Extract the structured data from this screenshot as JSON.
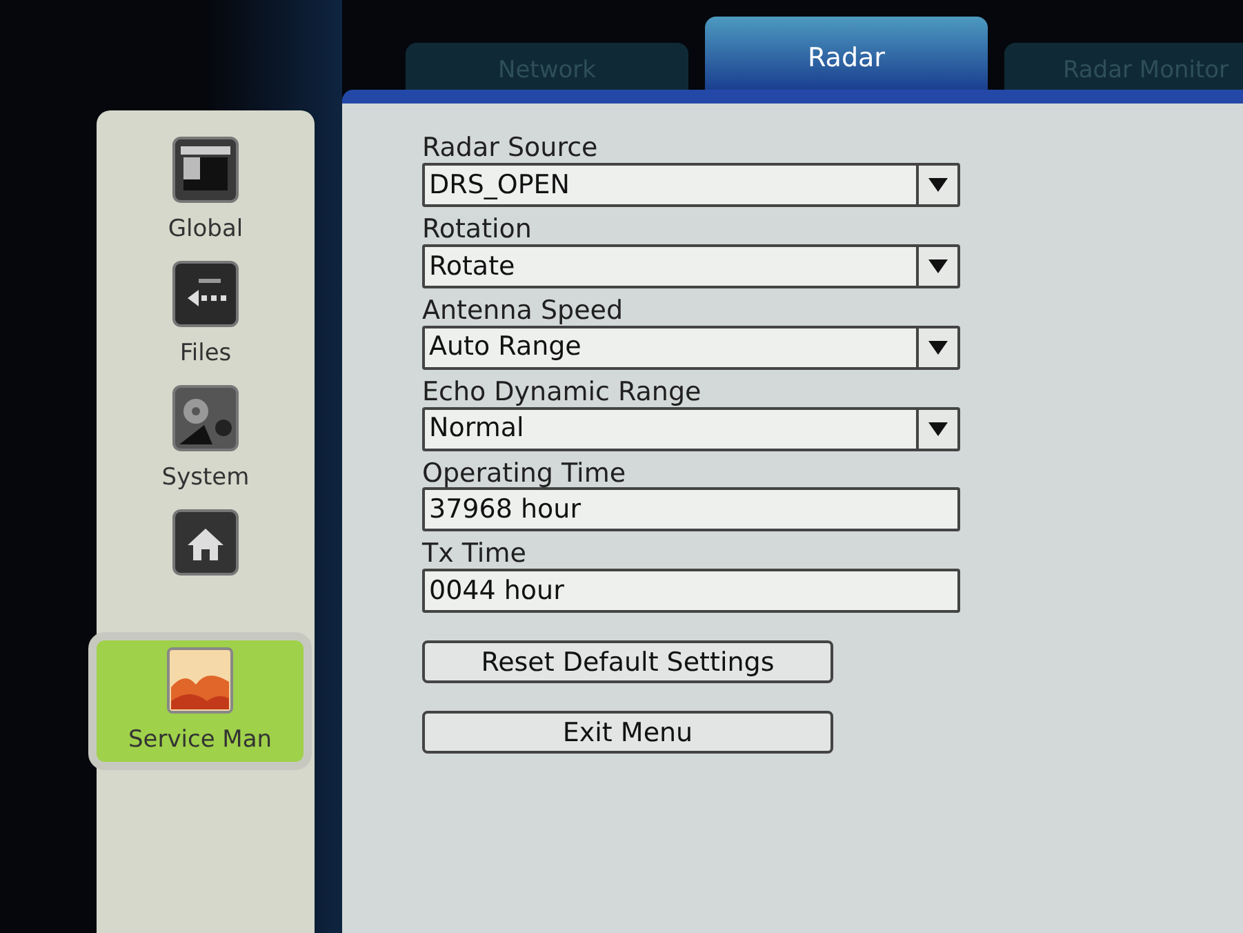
{
  "tabs": [
    {
      "label": "Network",
      "selected": false
    },
    {
      "label": "Radar",
      "selected": true
    },
    {
      "label": "Radar Monitor",
      "selected": false
    }
  ],
  "sidebar": {
    "items": [
      {
        "label": "Global",
        "selected": false
      },
      {
        "label": "Files",
        "selected": false
      },
      {
        "label": "System",
        "selected": false
      },
      {
        "selected": false
      },
      {
        "label": "Service Man",
        "selected": true
      }
    ]
  },
  "form": {
    "fields": [
      {
        "kind": "dropdown",
        "label": "Radar Source",
        "value": "DRS_OPEN"
      },
      {
        "kind": "dropdown",
        "label": "Rotation",
        "value": "Rotate"
      },
      {
        "kind": "dropdown",
        "label": "Antenna Speed",
        "value": "Auto Range"
      },
      {
        "kind": "dropdown",
        "label": "Echo Dynamic Range",
        "value": "Normal"
      },
      {
        "kind": "text",
        "label": "Operating Time",
        "value": "37968 hour"
      },
      {
        "kind": "text",
        "label": "Tx Time",
        "value": "0044 hour"
      }
    ],
    "buttons": [
      "Reset Default Settings",
      "Exit Menu"
    ]
  }
}
